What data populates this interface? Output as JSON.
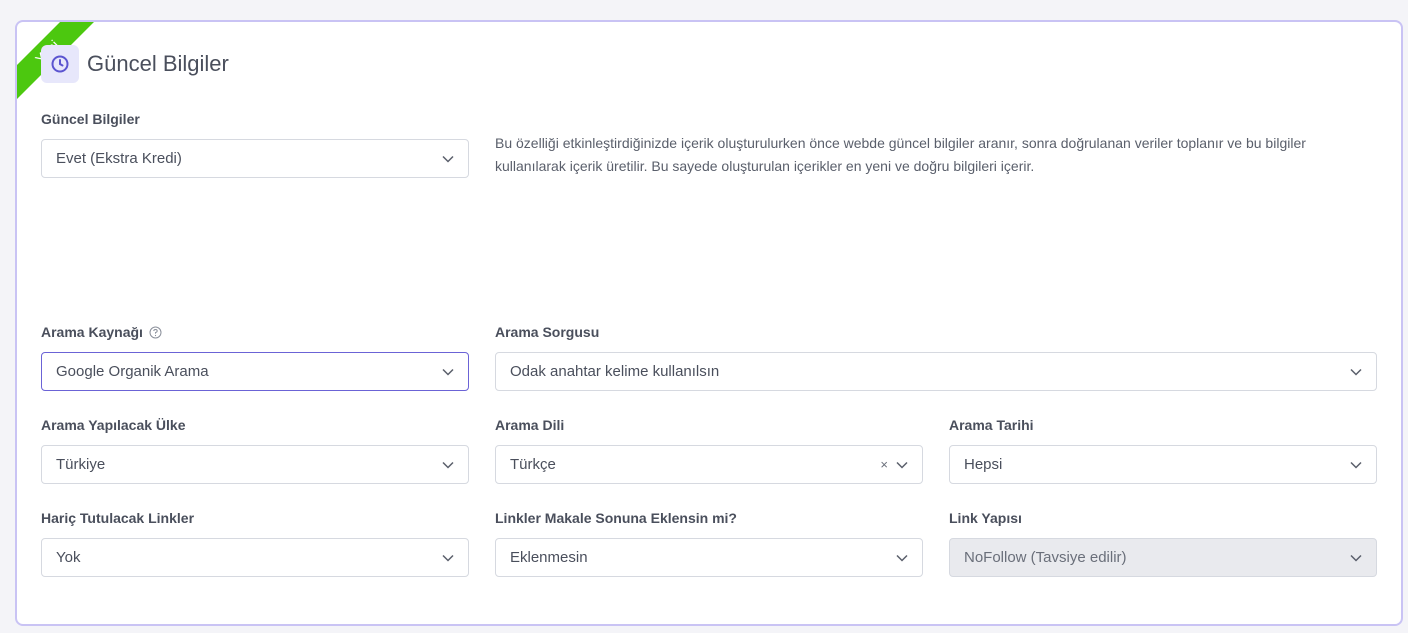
{
  "ribbon": "Yeni",
  "header": {
    "title": "Güncel Bilgiler",
    "icon": "clock-icon"
  },
  "fields": {
    "guncel_bilgiler": {
      "label": "Güncel Bilgiler",
      "value": "Evet (Ekstra Kredi)"
    },
    "description": "Bu özelliği etkinleştirdiğinizde içerik oluşturulurken önce webde güncel bilgiler aranır, sonra doğrulanan veriler toplanır ve bu bilgiler kullanılarak içerik üretilir. Bu sayede oluşturulan içerikler en yeni ve doğru bilgileri içerir.",
    "arama_kaynagi": {
      "label": "Arama Kaynağı",
      "value": "Google Organik Arama"
    },
    "arama_sorgusu": {
      "label": "Arama Sorgusu",
      "value": "Odak anahtar kelime kullanılsın"
    },
    "arama_ulke": {
      "label": "Arama Yapılacak Ülke",
      "value": "Türkiye"
    },
    "arama_dili": {
      "label": "Arama Dili",
      "value": "Türkçe",
      "clear": "×"
    },
    "arama_tarihi": {
      "label": "Arama Tarihi",
      "value": "Hepsi"
    },
    "haric_linkler": {
      "label": "Hariç Tutulacak Linkler",
      "value": "Yok"
    },
    "linkler_sonuna": {
      "label": "Linkler Makale Sonuna Eklensin mi?",
      "value": "Eklenmesin"
    },
    "link_yapisi": {
      "label": "Link Yapısı",
      "value": "NoFollow (Tavsiye edilir)"
    }
  },
  "colors": {
    "accent": "#6b63d6",
    "ribbon": "#4cc80f",
    "card_border": "#c9c3f4"
  }
}
